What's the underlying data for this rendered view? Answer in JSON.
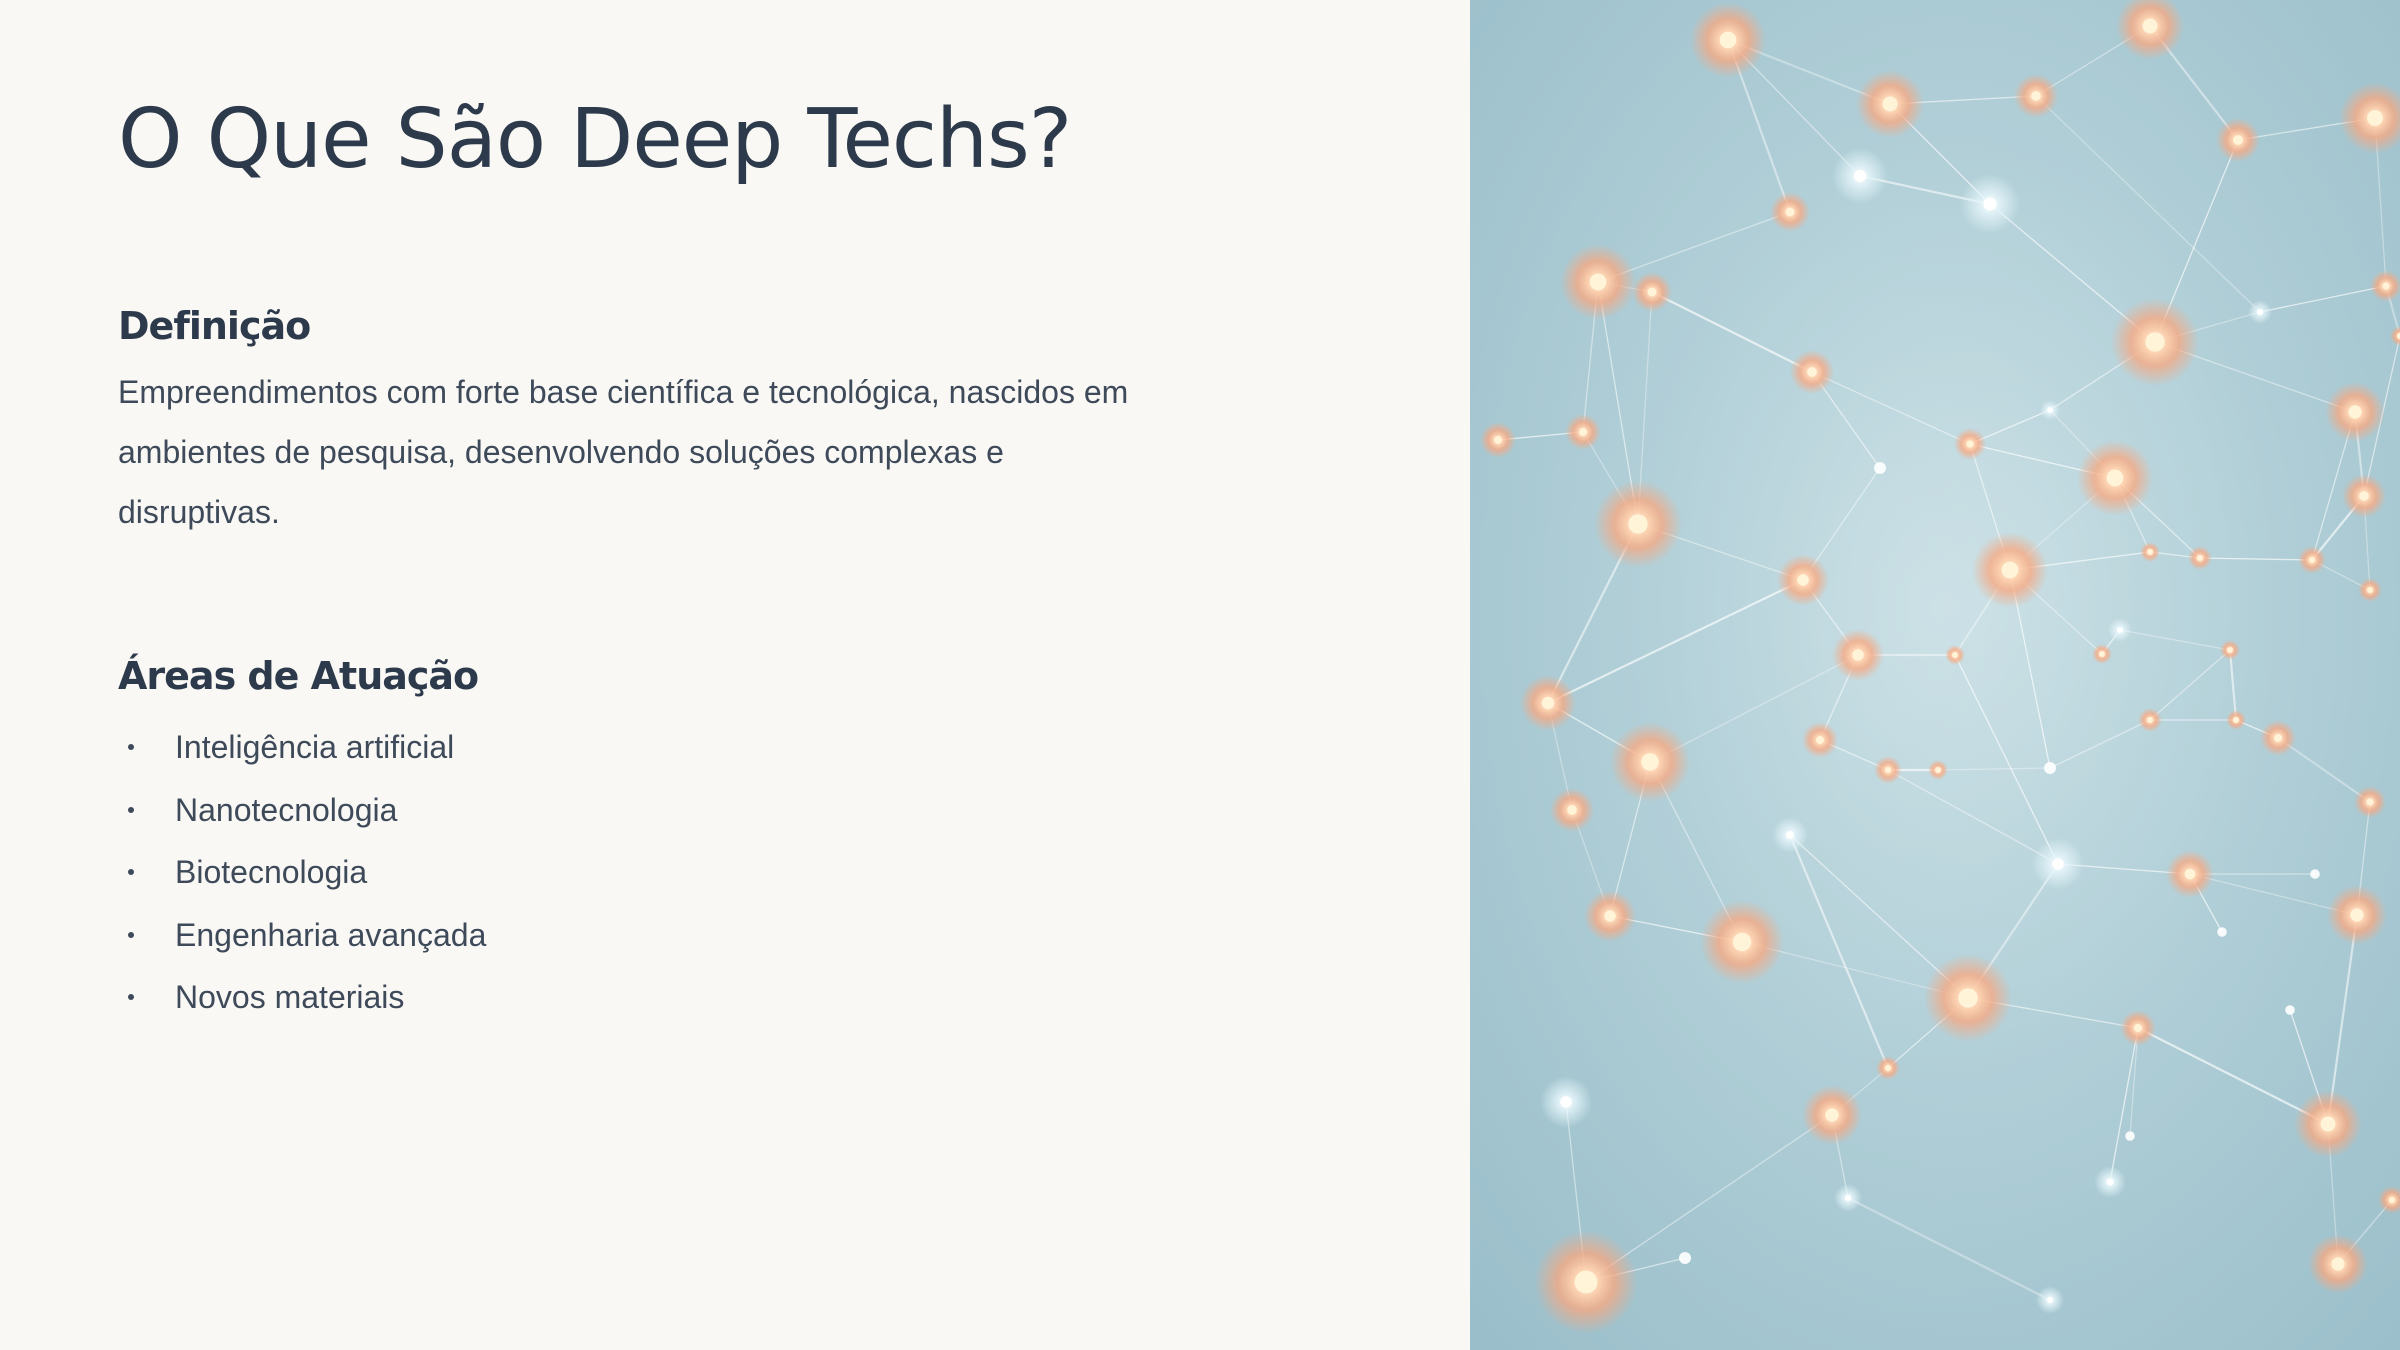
{
  "slide": {
    "title": "O Que São Deep Techs?",
    "definition": {
      "heading": "Definição",
      "text": "Empreendimentos com forte base científica e tecnológica, nascidos em ambientes de pesquisa, desenvolvendo soluções complexas e disruptivas."
    },
    "areas": {
      "heading": "Áreas de Atuação",
      "items": [
        "Inteligência artificial",
        "Nanotecnologia",
        "Biotecnologia",
        "Engenharia avançada",
        "Novos materiais"
      ]
    }
  },
  "image": {
    "icon": "neural-network-illustration",
    "colors": {
      "background": "#aecdd6",
      "node_warm": "#f9a77f",
      "node_core": "#fff4d8",
      "node_cool": "#e6f6fb",
      "link": "#ffffff"
    }
  }
}
